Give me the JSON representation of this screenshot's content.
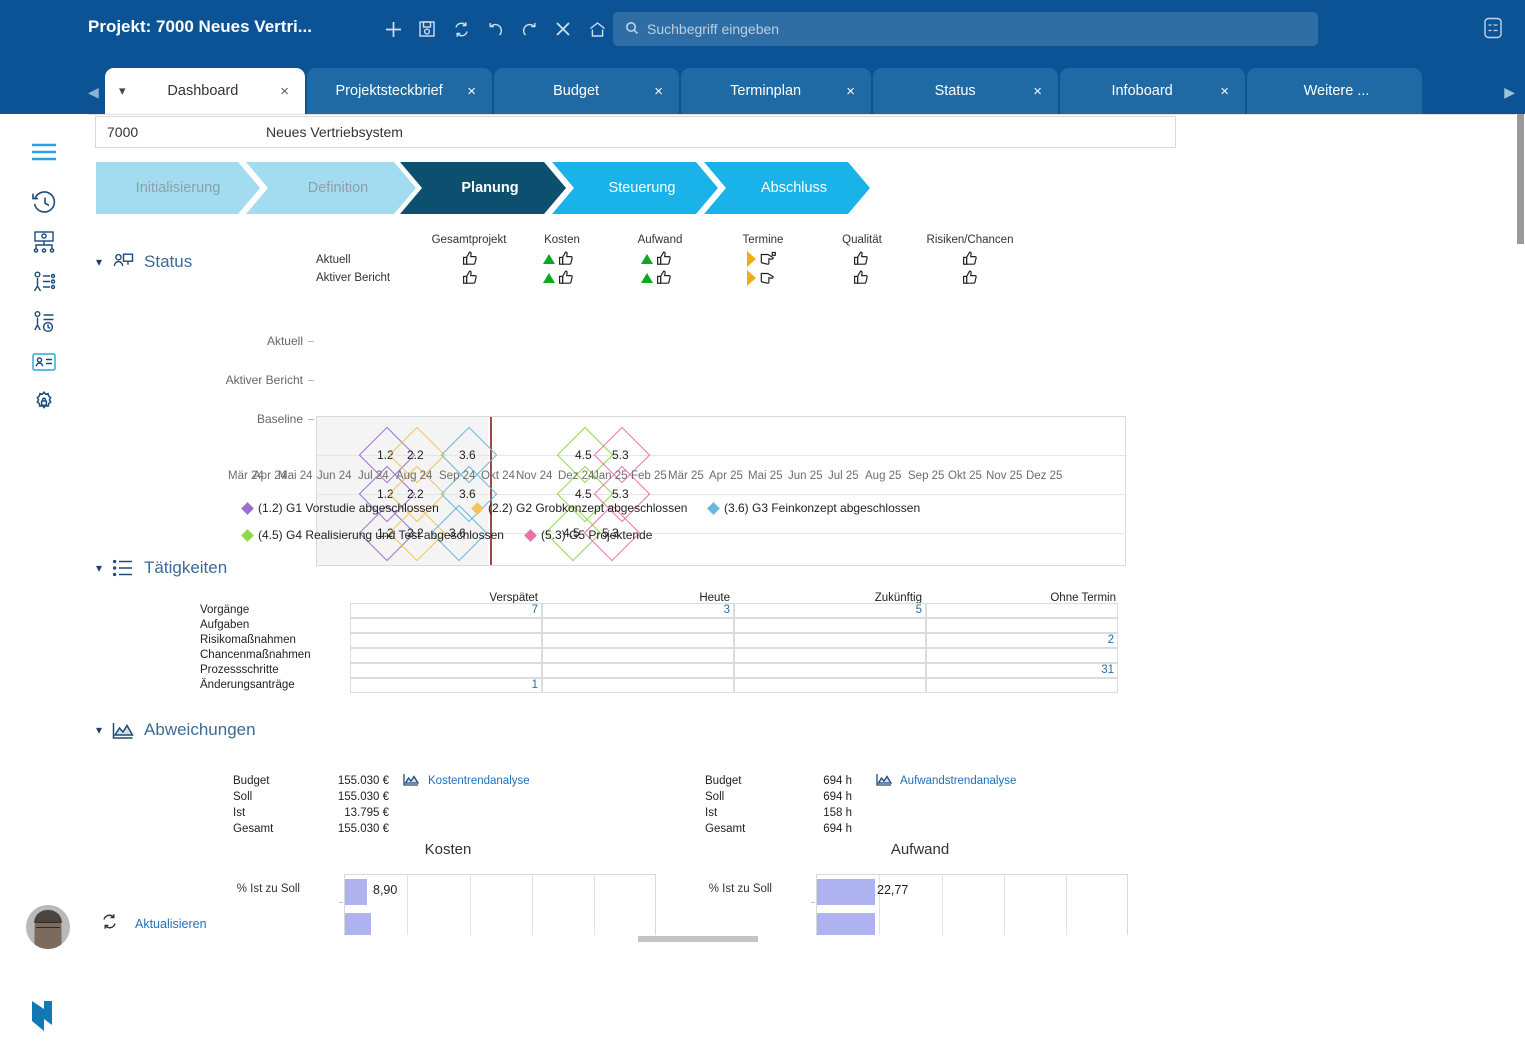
{
  "header": {
    "title": "Projekt: 7000 Neues Vertri...",
    "toolbar_icons": [
      "plus-icon",
      "save-icon",
      "refresh-icon",
      "undo-icon",
      "redo-icon",
      "close-icon",
      "home-icon"
    ],
    "search": {
      "placeholder": "Suchbegriff eingeben",
      "value": "",
      "icon": "search-icon"
    },
    "right_icon": "task-list-icon"
  },
  "tabs": [
    {
      "label": "Dashboard",
      "active": true,
      "has_dropdown": true,
      "close": "×"
    },
    {
      "label": "Projektsteckbrief",
      "active": false,
      "has_dropdown": false,
      "close": "×"
    },
    {
      "label": "Budget",
      "active": false,
      "has_dropdown": false,
      "close": "×"
    },
    {
      "label": "Terminplan",
      "active": false,
      "has_dropdown": false,
      "close": "×"
    },
    {
      "label": "Status",
      "active": false,
      "has_dropdown": false,
      "close": "×"
    },
    {
      "label": "Infoboard",
      "active": false,
      "has_dropdown": false,
      "close": "×"
    },
    {
      "label": "Weitere ...",
      "active": false,
      "has_dropdown": false,
      "close": ""
    }
  ],
  "sidebar": {
    "items": [
      {
        "icon": "hamburger-menu-icon",
        "name": "menu"
      },
      {
        "icon": "history-clock-icon",
        "name": "history"
      },
      {
        "icon": "org-chart-icon",
        "name": "org-structure"
      },
      {
        "icon": "person-tasks-icon",
        "name": "resources"
      },
      {
        "icon": "person-time-icon",
        "name": "time-recording"
      },
      {
        "icon": "id-card-icon",
        "name": "contacts"
      },
      {
        "icon": "gear-lock-icon",
        "name": "settings"
      }
    ],
    "avatar": "user-avatar",
    "logo": "brand-logo"
  },
  "project": {
    "id": "7000",
    "name": "Neues Vertriebsystem"
  },
  "phases": [
    {
      "label": "Initialisierung",
      "state": "done"
    },
    {
      "label": "Definition",
      "state": "done"
    },
    {
      "label": "Planung",
      "state": "current"
    },
    {
      "label": "Steuerung",
      "state": "future"
    },
    {
      "label": "Abschluss",
      "state": "future"
    }
  ],
  "status_section": {
    "title": "Status",
    "icon": "status-presentation-icon",
    "columns": [
      "Gesamtprojekt",
      "Kosten",
      "Aufwand",
      "Termine",
      "Qualität",
      "Risiken/Chancen"
    ],
    "rows": [
      {
        "label": "Aktuell",
        "cells": [
          {
            "trend": "none",
            "thumb": "up"
          },
          {
            "trend": "up",
            "thumb": "up"
          },
          {
            "trend": "up",
            "thumb": "up"
          },
          {
            "trend": "right",
            "thumb": "side"
          },
          {
            "trend": "none",
            "thumb": "up"
          },
          {
            "trend": "none",
            "thumb": "up"
          }
        ]
      },
      {
        "label": "Aktiver Bericht",
        "cells": [
          {
            "trend": "none",
            "thumb": "up"
          },
          {
            "trend": "up",
            "thumb": "up"
          },
          {
            "trend": "up",
            "thumb": "up"
          },
          {
            "trend": "right",
            "thumb": "side"
          },
          {
            "trend": "none",
            "thumb": "up"
          },
          {
            "trend": "none",
            "thumb": "up"
          }
        ]
      }
    ]
  },
  "chart_data": {
    "type": "scatter",
    "title": "",
    "xlabel": "",
    "ylabel": "",
    "grid": true,
    "legend_position": "bottom",
    "y_categories": [
      "Aktuell",
      "Aktiver Bericht",
      "Baseline"
    ],
    "x_ticks": [
      "Mär 24",
      "Apr 24",
      "Mai 24",
      "Jun 24",
      "Jul 24",
      "Aug 24",
      "Sep 24",
      "Okt 24",
      "Nov 24",
      "Dez 24",
      "Jan 25",
      "Feb 25",
      "Mär 25",
      "Apr 25",
      "Mai 25",
      "Jun 25",
      "Jul 25",
      "Aug 25",
      "Sep 25",
      "Okt 25",
      "Nov 25",
      "Dez 25"
    ],
    "today_marker_x": "Aug 24",
    "series": [
      {
        "name": "(1.2) G1 Vorstudie abgeschlossen",
        "label": "1.2",
        "color": "#9b6fd0",
        "values": [
          {
            "row": "Aktuell",
            "x": 1.45
          },
          {
            "row": "Aktiver Bericht",
            "x": 1.45
          },
          {
            "row": "Baseline",
            "x": 1.45
          }
        ]
      },
      {
        "name": "(2.2) G2 Grobkonzept abgeschlossen",
        "label": "2.2",
        "color": "#f2c45a",
        "values": [
          {
            "row": "Aktuell",
            "x": 2.35
          },
          {
            "row": "Aktiver Bericht",
            "x": 2.35
          },
          {
            "row": "Baseline",
            "x": 2.35
          }
        ]
      },
      {
        "name": "(3.6) G3 Feinkonzept abgeschlossen",
        "label": "3.6",
        "color": "#66b6dd",
        "values": [
          {
            "row": "Aktuell",
            "x": 4.3
          },
          {
            "row": "Aktiver Bericht",
            "x": 4.3
          },
          {
            "row": "Baseline",
            "x": 4.1
          }
        ]
      },
      {
        "name": "(4.5) G4 Realisierung und Test abgeschlossen",
        "label": "4.5",
        "color": "#8ed84a",
        "values": [
          {
            "row": "Aktuell",
            "x": 9.0
          },
          {
            "row": "Aktiver Bericht",
            "x": 9.0
          },
          {
            "row": "Baseline",
            "x": 8.7
          }
        ]
      },
      {
        "name": "(5.3) G5 Projektende",
        "label": "5.3",
        "color": "#f06fa5",
        "values": [
          {
            "row": "Aktuell",
            "x": 10.3
          },
          {
            "row": "Aktiver Bericht",
            "x": 10.3
          },
          {
            "row": "Baseline",
            "x": 10.1
          }
        ]
      }
    ]
  },
  "activities_section": {
    "title": "Tätigkeiten",
    "icon": "list-icon",
    "columns": [
      "Verspätet",
      "Heute",
      "Zukünftig",
      "Ohne Termin"
    ],
    "rows": [
      {
        "label": "Vorgänge",
        "values": [
          "7",
          "3",
          "5",
          ""
        ]
      },
      {
        "label": "Aufgaben",
        "values": [
          "",
          "",
          "",
          ""
        ]
      },
      {
        "label": "Risikomaßnahmen",
        "values": [
          "",
          "",
          "",
          "2"
        ]
      },
      {
        "label": "Chancenmaßnahmen",
        "values": [
          "",
          "",
          "",
          ""
        ]
      },
      {
        "label": "Prozessschritte",
        "values": [
          "",
          "",
          "",
          "31"
        ]
      },
      {
        "label": "Änderungsanträge",
        "values": [
          "1",
          "",
          "",
          ""
        ]
      }
    ]
  },
  "deviations_section": {
    "title": "Abweichungen",
    "icon": "chart-area-icon",
    "kosten": {
      "link": "Kostentrendanalyse",
      "link_icon": "trend-chart-icon",
      "rows": [
        {
          "label": "Budget",
          "value": "155.030 €"
        },
        {
          "label": "Soll",
          "value": "155.030 €"
        },
        {
          "label": "Ist",
          "value": "13.795 €"
        },
        {
          "label": "Gesamt",
          "value": "155.030 €"
        }
      ]
    },
    "aufwand": {
      "link": "Aufwandstrendanalyse",
      "link_icon": "trend-chart-icon",
      "rows": [
        {
          "label": "Budget",
          "value": "694 h"
        },
        {
          "label": "Soll",
          "value": "694 h"
        },
        {
          "label": "Ist",
          "value": "158 h"
        },
        {
          "label": "Gesamt",
          "value": "694 h"
        }
      ]
    }
  },
  "mini_charts": [
    {
      "title": "Kosten",
      "axis_label": "% Ist zu Soll",
      "value": "8,90",
      "value_number": 8.9,
      "bar_color": "#aeb3f0",
      "xmax": 100
    },
    {
      "title": "Aufwand",
      "axis_label": "% Ist zu Soll",
      "value": "22,77",
      "value_number": 22.77,
      "bar_color": "#aeb3f0",
      "xmax": 100
    }
  ],
  "footer": {
    "refresh_label": "Aktualisieren",
    "refresh_icon": "refresh-icon"
  }
}
